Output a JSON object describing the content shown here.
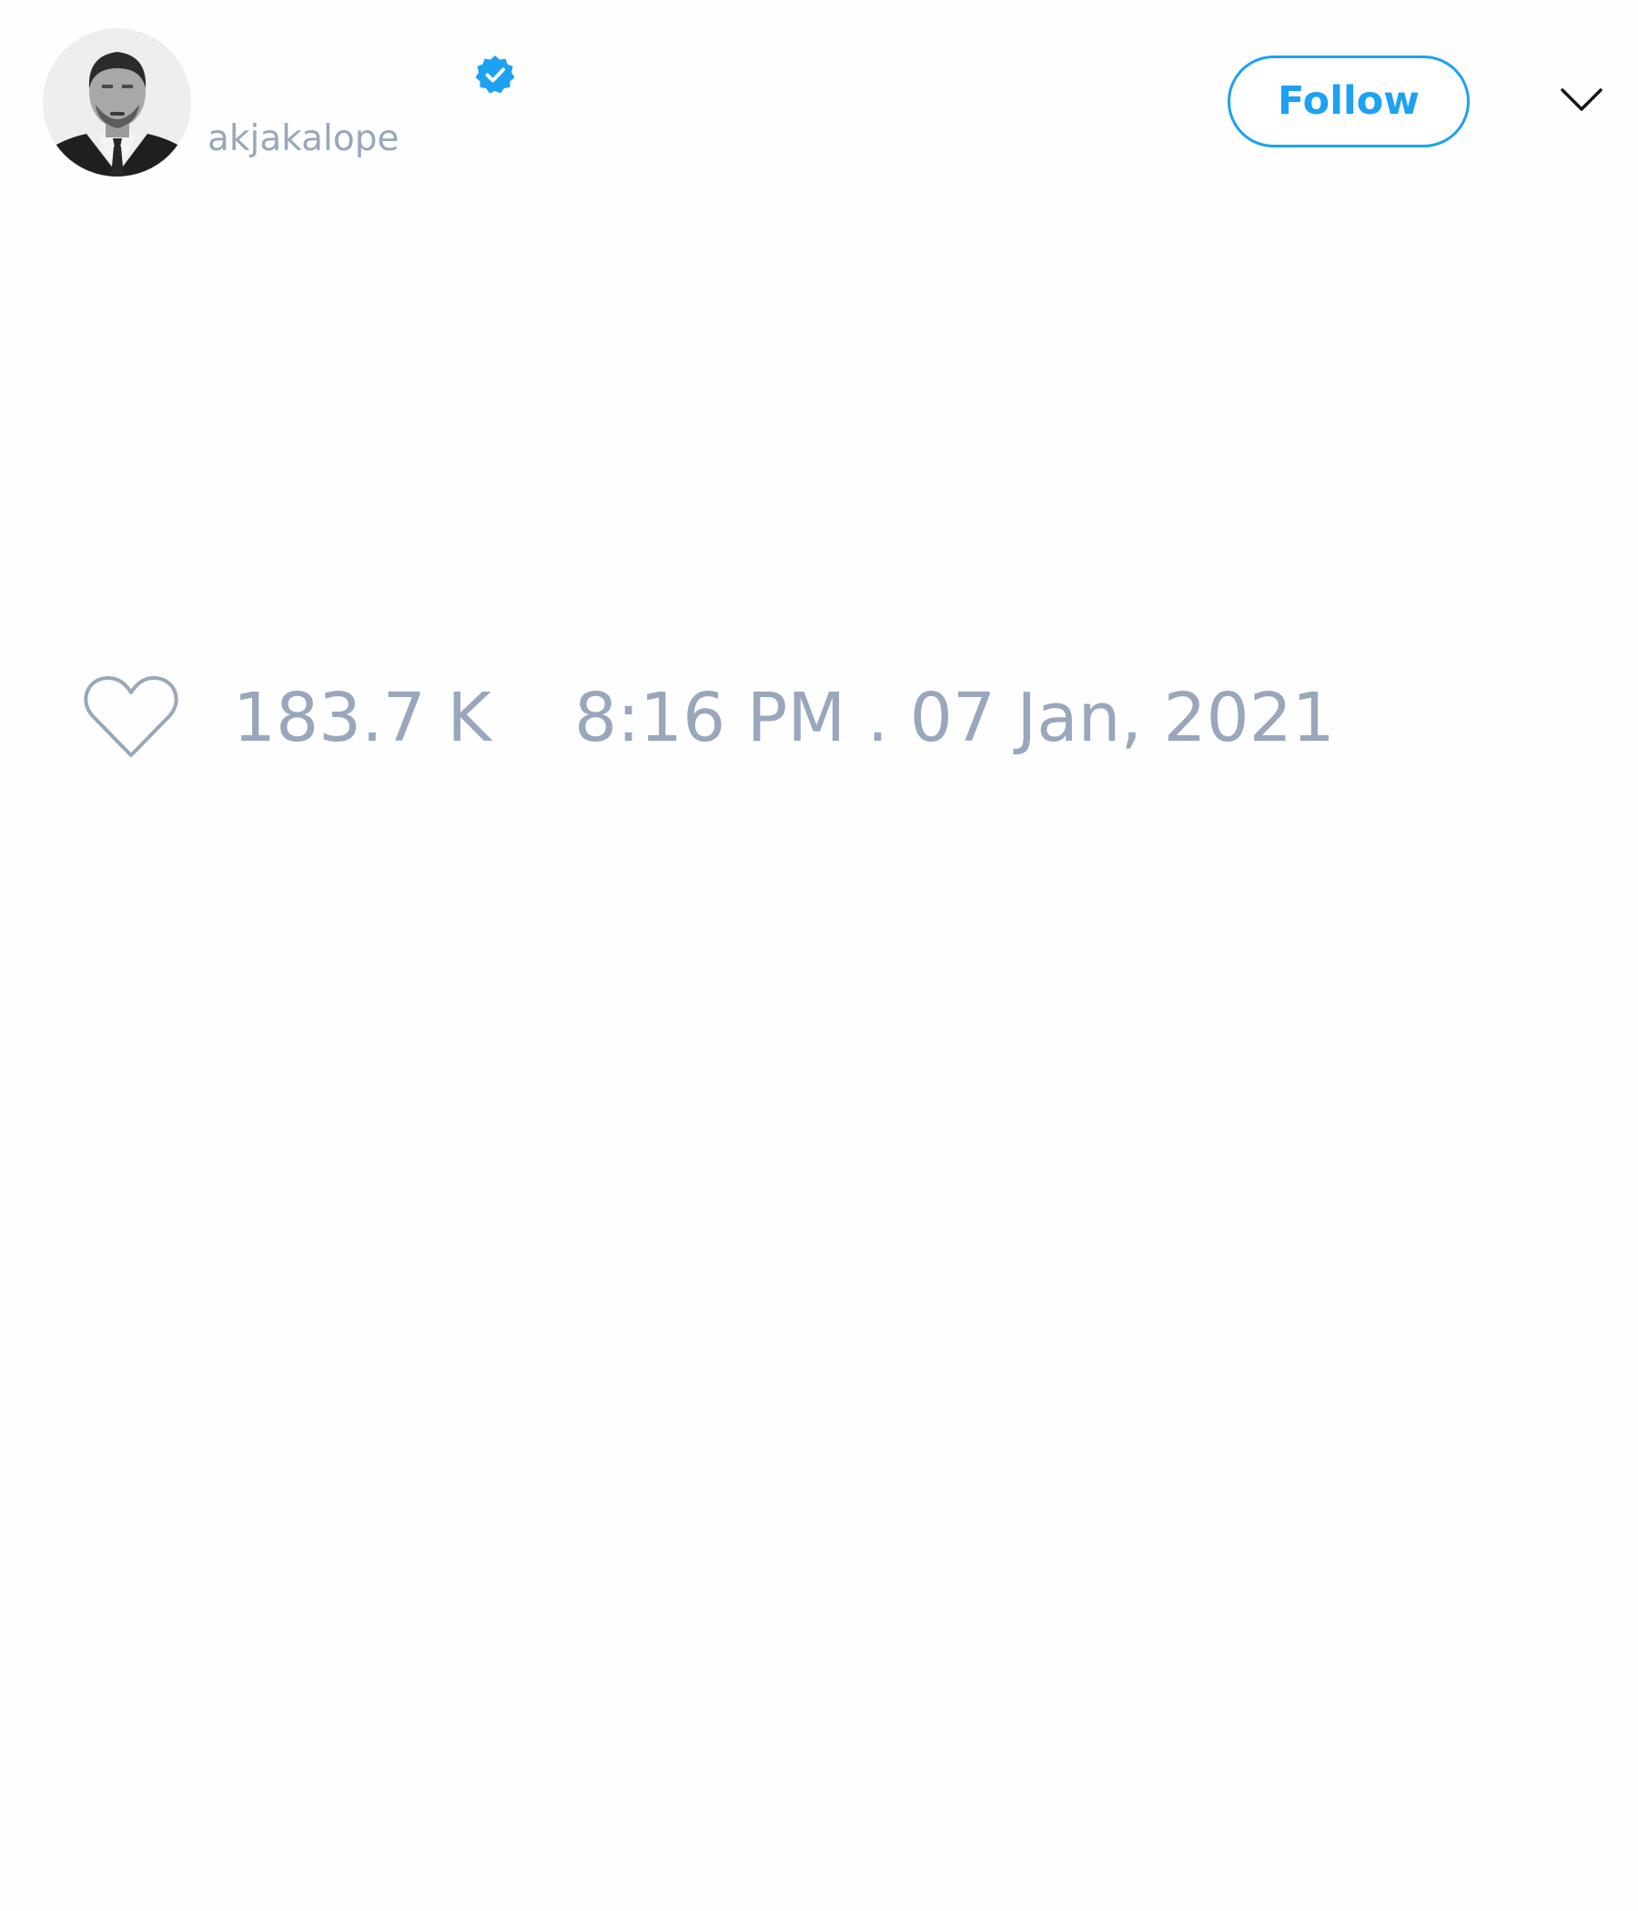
{
  "tweet": {
    "author": {
      "display_name": "",
      "handle": "akjakalope",
      "verified": true,
      "avatar_icon": "avatar-photo"
    },
    "follow_label": "Follow",
    "menu_icon": "chevron-down-icon",
    "like_icon": "heart-icon",
    "like_count": "183.7 K",
    "timestamp": "8:16 PM . 07 Jan, 2021"
  },
  "colors": {
    "accent": "#1da1f2",
    "muted_text": "#98a7bb",
    "background": "#fefefe"
  }
}
